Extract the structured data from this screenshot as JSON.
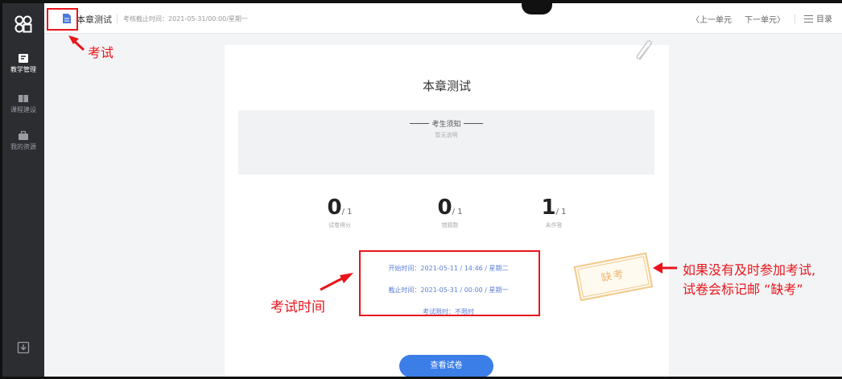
{
  "sidebar": {
    "logo": "app-logo",
    "items": [
      {
        "label": "教学管理",
        "icon": "teaching-icon",
        "active": true
      },
      {
        "label": "课程建设",
        "icon": "book-icon",
        "active": false
      },
      {
        "label": "我的资源",
        "icon": "briefcase-icon",
        "active": false
      }
    ],
    "bottom_icon": "download-icon"
  },
  "topbar": {
    "title": "本章测试",
    "deadline": "考核截止时间：2021-05-31/00:00/星期一",
    "prev": "〈上一单元",
    "next": "下一单元〉",
    "menu": "目录"
  },
  "card": {
    "title": "本章测试",
    "notice_title": "考生须知",
    "notice_body": "暂无说明",
    "stats": [
      {
        "value": "0",
        "total": "/ 1",
        "label": "试卷得分"
      },
      {
        "value": "0",
        "total": "/ 1",
        "label": "错题数"
      },
      {
        "value": "1",
        "total": "/ 1",
        "label": "未作答"
      }
    ],
    "start_time": "开始时间：2021-05-11 / 14:46 / 星期二",
    "end_time": "截止时间：2021-05-31 / 00:00 / 星期一",
    "time_limit": "考试限时：不限时",
    "stamp": "缺考",
    "view_button": "查看试卷"
  },
  "annotations": {
    "exam": "考试",
    "exam_time": "考试时间",
    "missed_line1": "如果没有及时参加考试,",
    "missed_line2": "试卷会标记邮 “缺考”",
    "color": "#e8151b"
  }
}
